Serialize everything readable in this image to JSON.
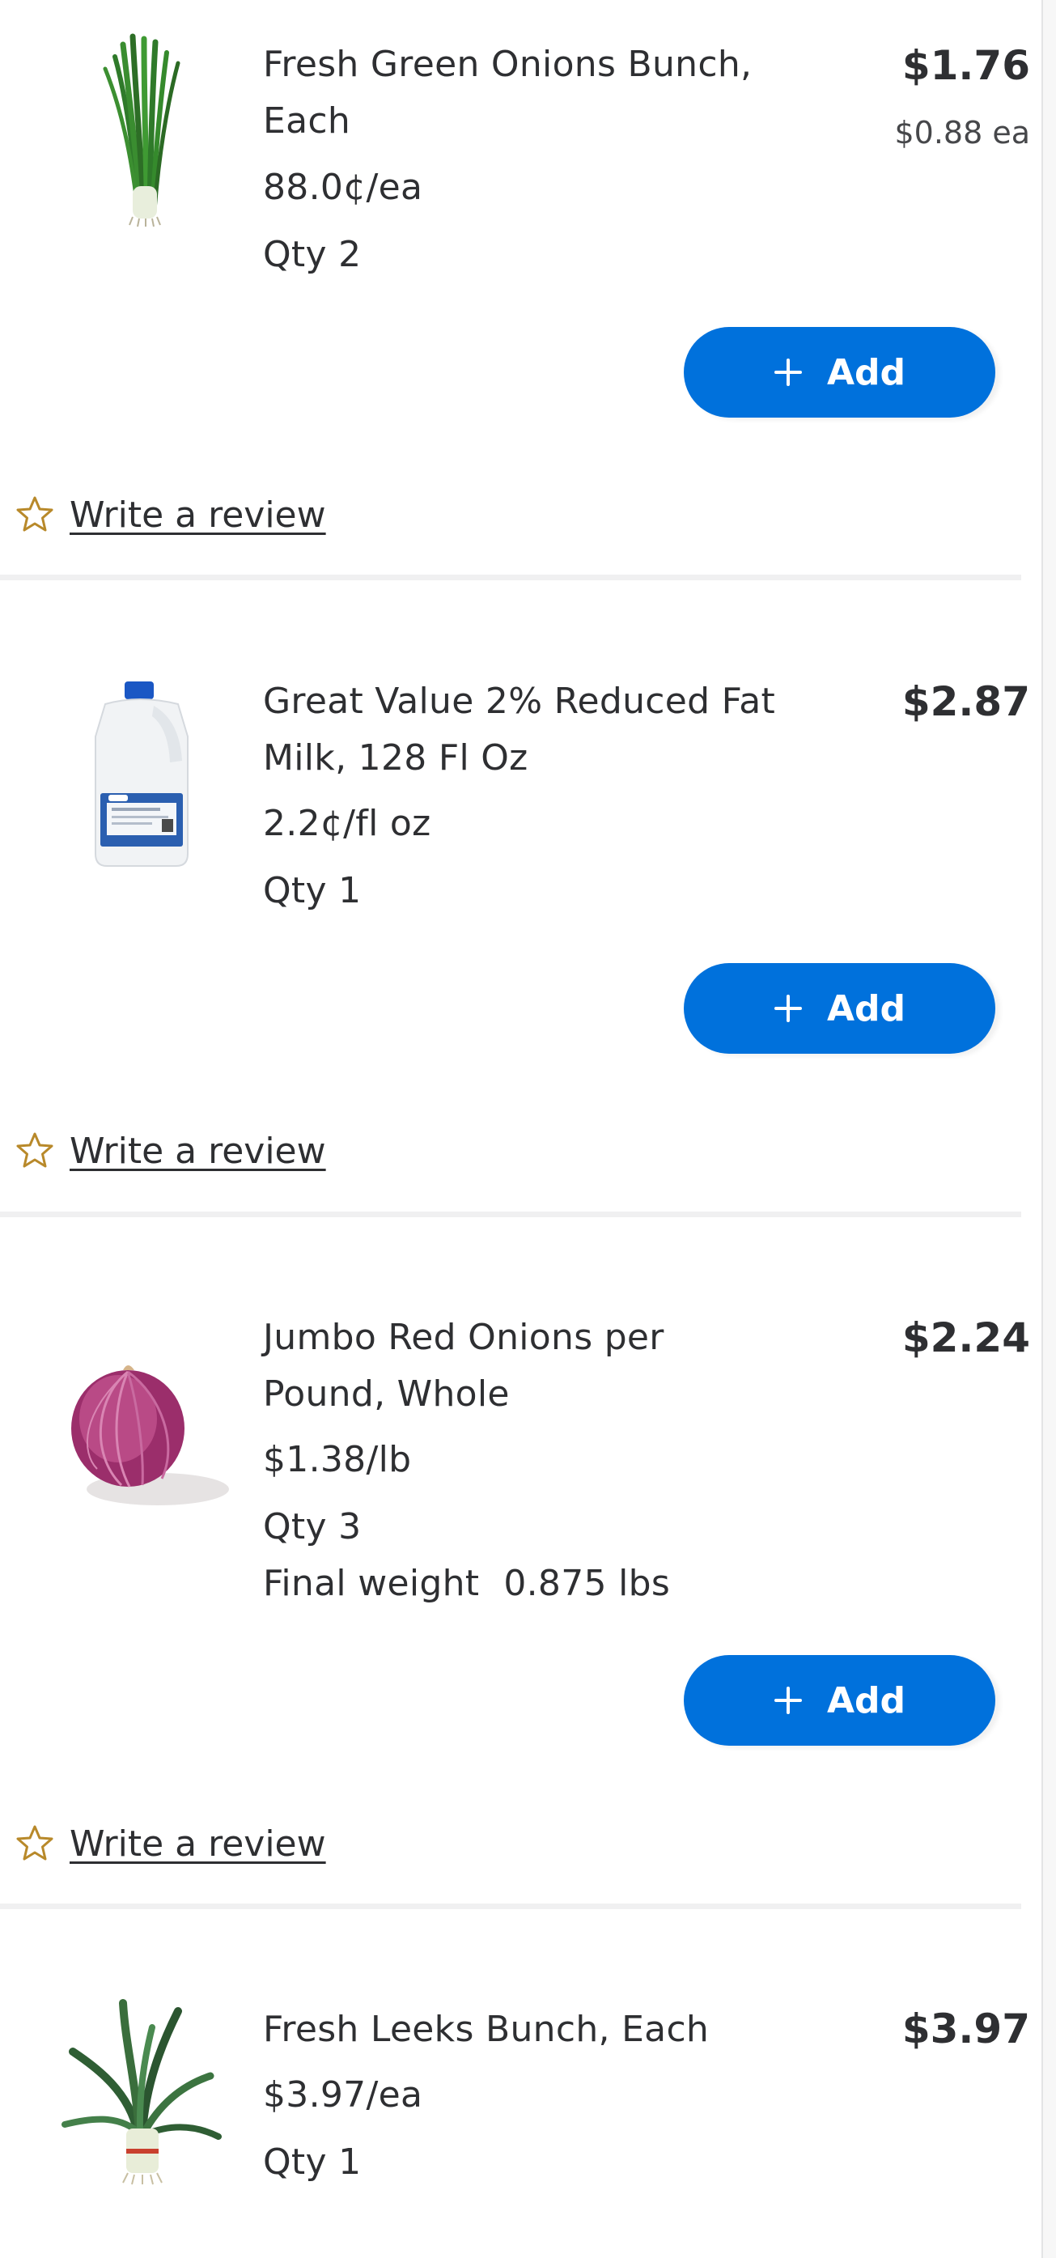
{
  "items": [
    {
      "image": "green-onions-image",
      "name": "Fresh Green Onions Bunch, Each",
      "price": "$1.76",
      "each_price": "$0.88 ea",
      "unit_price": "88.0¢/ea",
      "qty": "Qty 2",
      "add_label": "Add",
      "review_label": "Write a review"
    },
    {
      "image": "milk-jug-image",
      "name": "Great Value 2% Reduced Fat Milk, 128 Fl Oz",
      "price": "$2.87",
      "unit_price": "2.2¢/fl oz",
      "qty": "Qty 1",
      "add_label": "Add",
      "review_label": "Write a review"
    },
    {
      "image": "red-onion-image",
      "name": "Jumbo Red Onions per Pound, Whole",
      "price": "$2.24",
      "unit_price": "$1.38/lb",
      "qty": "Qty 3",
      "final_weight_label": "Final weight",
      "final_weight_value": "0.875 lbs",
      "add_label": "Add",
      "review_label": "Write a review"
    },
    {
      "image": "leeks-image",
      "name": "Fresh Leeks Bunch, Each",
      "price": "$3.97",
      "unit_price": "$3.97/ea",
      "qty": "Qty 1"
    }
  ],
  "icons": {
    "add": "plus-icon",
    "review": "star-outline-icon"
  },
  "colors": {
    "primary": "#0071dc",
    "text": "#2e2f32",
    "star": "#b8892a",
    "divider": "#f0f0f1"
  }
}
